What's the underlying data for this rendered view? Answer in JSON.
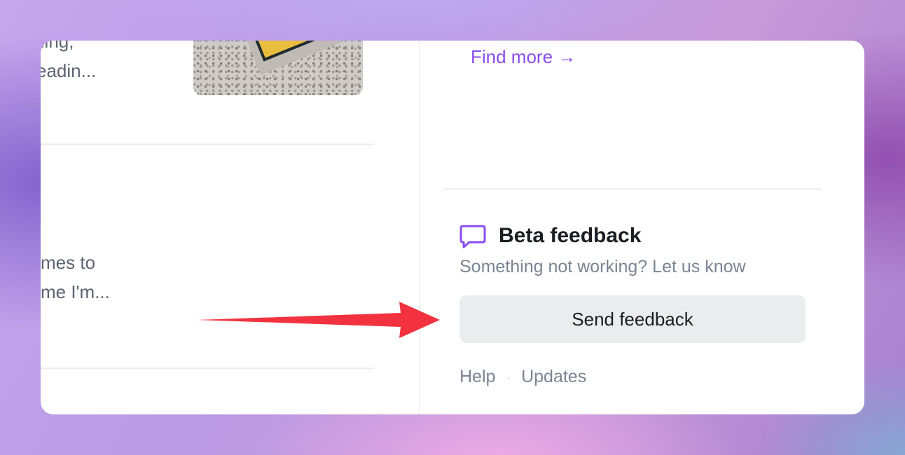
{
  "feed": {
    "item1": {
      "line1": "lling,",
      "line2": "eadin..."
    },
    "item2": {
      "line1": "mes to",
      "line2": "me I'm..."
    }
  },
  "sidebar": {
    "find_more": "Find more →",
    "beta_feedback": {
      "title": "Beta feedback",
      "subtitle": "Something not working? Let us know",
      "button_label": "Send feedback",
      "icon": "chat-bubble-icon"
    },
    "footer": {
      "help": "Help",
      "separator": "·",
      "updates": "Updates"
    }
  },
  "annotation": {
    "arrow_color": "#f2323f"
  },
  "colors": {
    "accent": "#8a4df0",
    "button_bg": "#eaeced"
  }
}
